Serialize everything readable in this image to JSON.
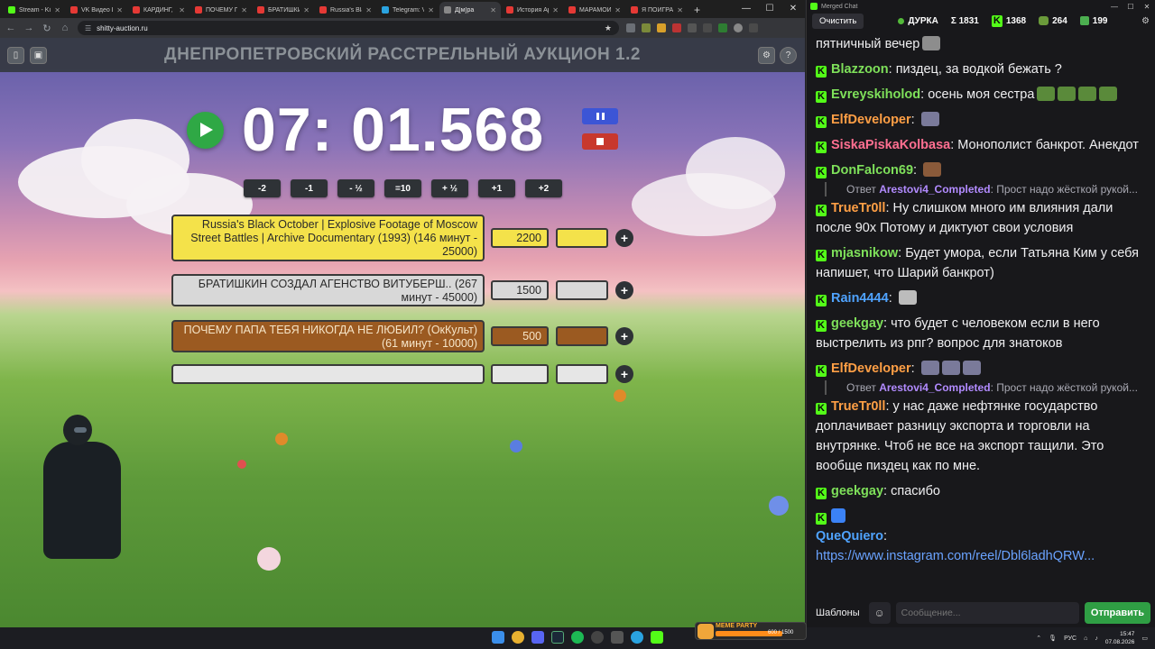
{
  "browser": {
    "tabs": [
      {
        "label": "Stream - Ki",
        "color": "#53fc18"
      },
      {
        "label": "VK Видео Li",
        "color": "#e53935"
      },
      {
        "label": "КАРДИНГ, I",
        "color": "#e53935"
      },
      {
        "label": "ПОЧЕМУ ПА",
        "color": "#e53935"
      },
      {
        "label": "БРАТИШКИ",
        "color": "#e53935"
      },
      {
        "label": "Russia's Bla",
        "color": "#e53935"
      },
      {
        "label": "Telegram: V",
        "color": "#2aa3e0"
      },
      {
        "label": "Д[м]ра",
        "color": "#888888",
        "active": true
      },
      {
        "label": "История Ар",
        "color": "#e53935"
      },
      {
        "label": "МАРАМОЙ",
        "color": "#e53935"
      },
      {
        "label": "Я ПОИГРАЛ",
        "color": "#e53935"
      }
    ],
    "new_tab": "+",
    "url": "shitty-auction.ru"
  },
  "auction": {
    "title": "ДНЕПРОПЕТРОВСКИЙ РАССТРЕЛЬНЫЙ АУКЦИОН 1.2",
    "timer": "07: 01.568",
    "adjust_buttons": [
      "-2",
      "-1",
      "- ½",
      "=10",
      "+ ½",
      "+1",
      "+2"
    ],
    "lots": [
      {
        "title": "Russia's Black October | Explosive Footage of Moscow Street Battles | Archive Documentary (1993) (146 минут - 25000)",
        "sum": "2200",
        "style": "yellow"
      },
      {
        "title": "БРАТИШКИН СОЗДАЛ АГЕНСТВО ВИТУБЕРШ.. (267 минут - 45000)",
        "sum": "1500",
        "style": "grey"
      },
      {
        "title": "ПОЧЕМУ ПАПА ТЕБЯ НИКОГДА НЕ ЛЮБИЛ? (ОкКульт) (61 минут - 10000)",
        "sum": "500",
        "style": "brown"
      },
      {
        "title": "",
        "sum": "",
        "style": "lightgrey"
      }
    ],
    "plus_label": "+"
  },
  "chat": {
    "window_title": "Merged Chat",
    "clear_label": "Очистить",
    "stats": {
      "name": "ДУРКА",
      "sum": "Σ 1831",
      "kick": "1368",
      "s2": "264",
      "s3": "199"
    },
    "messages": [
      {
        "user": "",
        "color": "#ffffff",
        "text": "пятничный вечер",
        "emotes": [
          "#8d8d8d"
        ],
        "nobadge": true
      },
      {
        "user": "Blazzoon",
        "color": "#7ee05a",
        "text": "пиздец, за водкой бежать ?"
      },
      {
        "user": "Evreyskiholod",
        "color": "#7ee05a",
        "text": "осень моя сестра",
        "emotes": [
          "#5a8a3a",
          "#5a8a3a",
          "#5a8a3a",
          "#5a8a3a"
        ]
      },
      {
        "user": "ElfDeveloper",
        "color": "#ff9f45",
        "text": "",
        "emotes": [
          "#7a7a9a"
        ]
      },
      {
        "user": "SiskaPiskaKolbasa",
        "color": "#ff6f91",
        "text": "Монополист банкрот. Анекдот"
      },
      {
        "user": "DonFalcon69",
        "color": "#7ee05a",
        "text": "",
        "emotes": [
          "#8a5a3a"
        ],
        "reply": {
          "name": "Arestovi4_Completed",
          "text": "Прост надо жёсткой рукой..."
        }
      },
      {
        "user": "TrueTr0ll",
        "color": "#ff9f45",
        "text": "Ну слишком много им влияния дали после 90х Потому и диктуют свои условия"
      },
      {
        "user": "mjasnikow",
        "color": "#7ee05a",
        "text": "Будет умора, если Татьяна Ким у себя напишет, что Шарий банкрот)"
      },
      {
        "user": "Rain4444",
        "color": "#4fa3ff",
        "text": "",
        "emotes": [
          "#bcbcbc"
        ]
      },
      {
        "user": "geekgay",
        "color": "#7ee05a",
        "text": "что будет с человеком если в него выстрелить из рпг? вопрос для знатоков"
      },
      {
        "user": "ElfDeveloper",
        "color": "#ff9f45",
        "text": "",
        "emotes": [
          "#7a7a9a",
          "#7a7a9a",
          "#7a7a9a"
        ],
        "reply": {
          "name": "Arestovi4_Completed",
          "text": "Прост надо жёсткой рукой..."
        }
      },
      {
        "user": "TrueTr0ll",
        "color": "#ff9f45",
        "text": "у нас даже нефтянке государство доплачивает разницу экспорта и торговли на внутрянке. Чтоб не все на экспорт тащили. Это вообще пиздец как по мне."
      },
      {
        "user": "geekgay",
        "color": "#7ee05a",
        "text": "спасибо"
      },
      {
        "user": "QueQuiero",
        "color": "#4fa3ff",
        "text": "",
        "link": "https://www.instagram.com/reel/Dbl6ladhQRW...",
        "prefix_emote": "#3b82f6"
      }
    ],
    "templates_label": "Шаблоны",
    "input_placeholder": "Сообщение...",
    "send_label": "Отправить"
  },
  "taskbar": {
    "widget_label": "MEME PARTY",
    "widget_count": "600 / 1500",
    "lang": "РУС",
    "time": "15:47",
    "date": "07.08.2026"
  }
}
